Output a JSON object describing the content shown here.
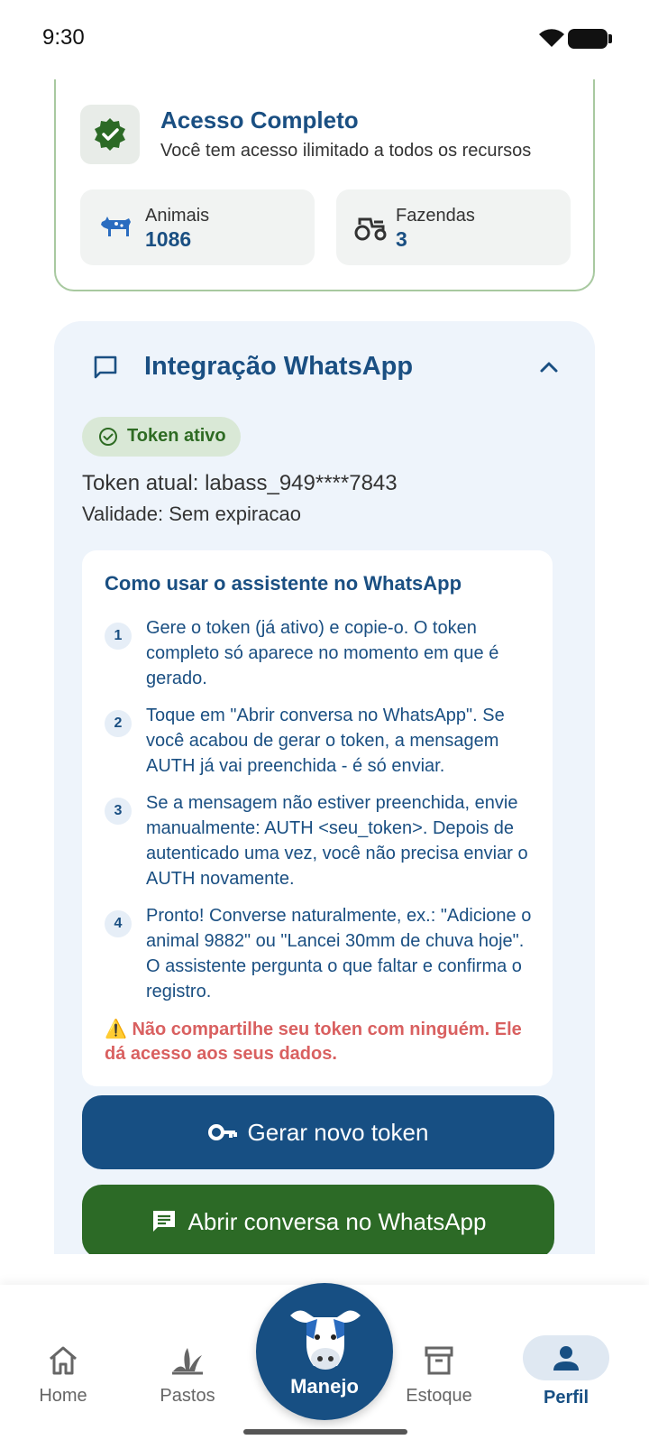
{
  "status_bar": {
    "time": "9:30"
  },
  "access": {
    "title": "Acesso Completo",
    "subtitle": "Você tem acesso ilimitado a todos os recursos",
    "stats": [
      {
        "label": "Animais",
        "value": "1086",
        "icon": "cow-icon"
      },
      {
        "label": "Fazendas",
        "value": "3",
        "icon": "tractor-icon"
      }
    ]
  },
  "whatsapp": {
    "title": "Integração WhatsApp",
    "chip": "Token ativo",
    "token_current": "Token atual: labass_949****7843",
    "validity": "Validade: Sem expiracao",
    "howto": {
      "title": "Como usar o assistente no WhatsApp",
      "steps": [
        {
          "num": "1",
          "text": "Gere o token (já ativo) e copie-o. O token completo só aparece no momento em que é gerado."
        },
        {
          "num": "2",
          "text": "Toque em \"Abrir conversa no WhatsApp\". Se você acabou de gerar o token, a mensagem AUTH já vai preenchida - é só enviar."
        },
        {
          "num": "3",
          "text": "Se a mensagem não estiver preenchida, envie manualmente: AUTH <seu_token>. Depois de autenticado uma vez, você não precisa enviar o AUTH novamente."
        },
        {
          "num": "4",
          "text": "Pronto! Converse naturalmente, ex.: \"Adicione o animal 9882\" ou \"Lancei 30mm de chuva hoje\". O assistente pergunta o que faltar e confirma o registro."
        }
      ],
      "warning": "⚠️ Não compartilhe seu token com ninguém. Ele dá acesso aos seus dados."
    },
    "btn_generate": "Gerar novo token",
    "btn_open": "Abrir conversa no WhatsApp"
  },
  "nav": {
    "items": [
      {
        "label": "Home",
        "icon": "home-icon"
      },
      {
        "label": "Pastos",
        "icon": "grass-icon"
      },
      {
        "label": "Manejo",
        "icon": "cow-logo-icon"
      },
      {
        "label": "Estoque",
        "icon": "archive-icon"
      },
      {
        "label": "Perfil",
        "icon": "person-icon",
        "active": true
      }
    ]
  },
  "colors": {
    "primary": "#174f83",
    "success": "#2c6a26",
    "warning": "#d96060",
    "section_bg": "#eef4fb"
  }
}
